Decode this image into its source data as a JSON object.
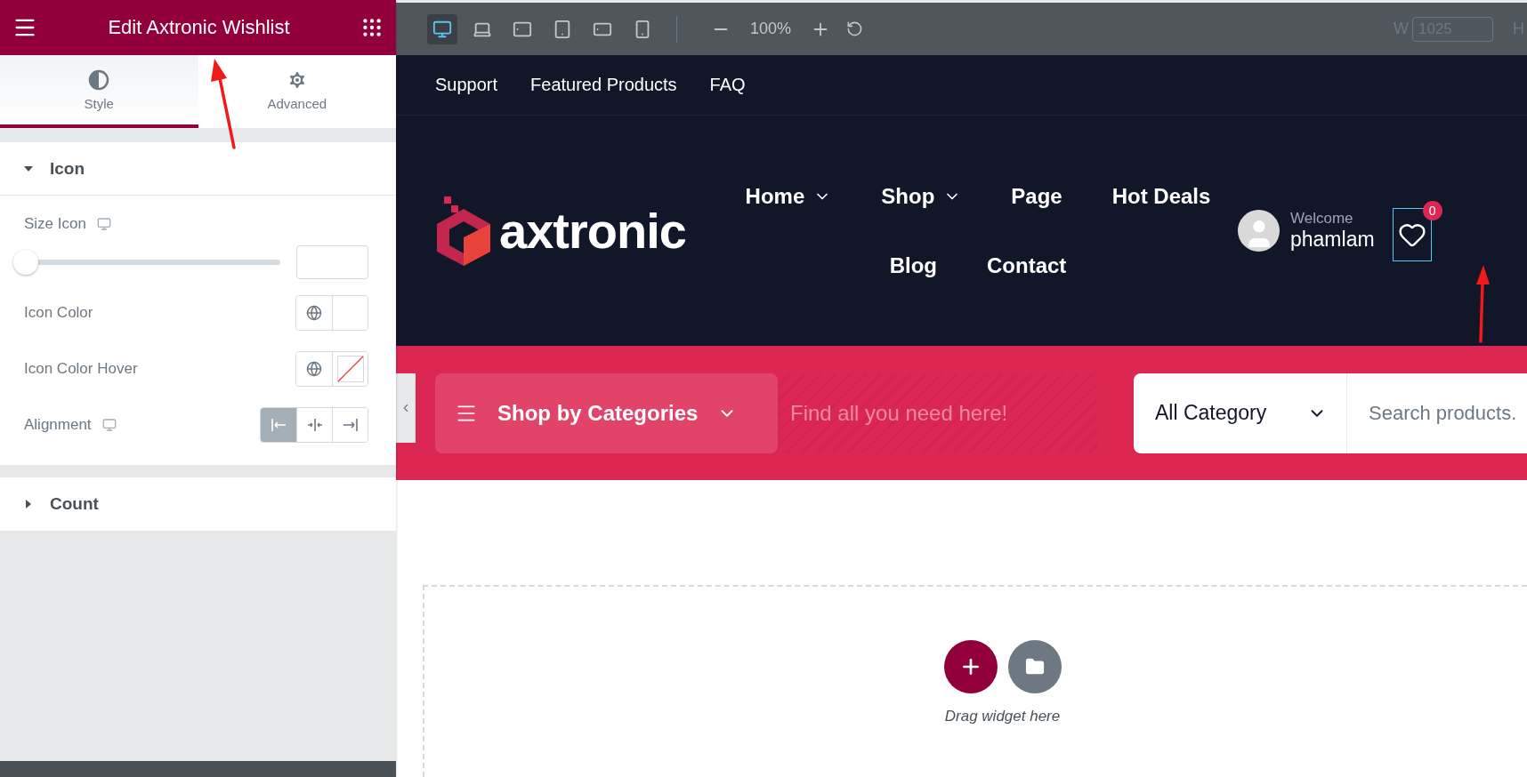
{
  "panel": {
    "title": "Edit Axtronic Wishlist",
    "tabs": [
      {
        "label": "Style",
        "kind": "style",
        "selected": true
      },
      {
        "label": "Advanced",
        "kind": "advanced",
        "selected": false
      }
    ],
    "sections": [
      {
        "title": "Icon",
        "expanded": true,
        "controls": [
          {
            "kind": "slider",
            "label": "Size Icon",
            "responsive": true,
            "level": 0
          },
          {
            "kind": "color",
            "label": "Icon Color",
            "responsive": false,
            "cleared": false
          },
          {
            "kind": "color",
            "label": "Icon Color Hover",
            "responsive": false,
            "cleared": true
          },
          {
            "kind": "choices",
            "label": "Alignment",
            "responsive": true,
            "options": [
              {
                "kind": "left",
                "selected": true
              },
              {
                "kind": "center",
                "selected": false
              },
              {
                "kind": "right",
                "selected": false
              }
            ]
          }
        ]
      },
      {
        "title": "Count",
        "expanded": false
      }
    ]
  },
  "toolbar": {
    "devices": [
      {
        "kind": "desktop",
        "selected": true
      },
      {
        "kind": "laptop",
        "selected": false
      },
      {
        "kind": "tablet-wide",
        "selected": false
      },
      {
        "kind": "tablet",
        "selected": false
      },
      {
        "kind": "mobile-wide",
        "selected": false
      },
      {
        "kind": "mobile",
        "selected": false
      }
    ],
    "zoom": "100%",
    "width_label": "W",
    "width_value": "1025",
    "height_label": "H"
  },
  "site": {
    "top_links": [
      "Support",
      "Featured Products",
      "FAQ"
    ],
    "logo": "axtronic",
    "menu_rows": [
      [
        {
          "label": "Home",
          "dropdown": true
        },
        {
          "label": "Shop",
          "dropdown": true
        },
        {
          "label": "Page",
          "dropdown": false
        },
        {
          "label": "Hot Deals",
          "dropdown": false
        }
      ],
      [
        {
          "label": "Blog",
          "dropdown": false
        },
        {
          "label": "Contact",
          "dropdown": false
        }
      ]
    ],
    "user": {
      "greeting": "Welcome",
      "name": "phamlam"
    },
    "wishlist": {
      "count": "0"
    },
    "category_button": "Shop by Categories",
    "tagline": "Find all you need here!",
    "search": {
      "category": "All Category",
      "placeholder": "Search products."
    }
  },
  "canvas": {
    "hint": "Drag widget here"
  }
}
